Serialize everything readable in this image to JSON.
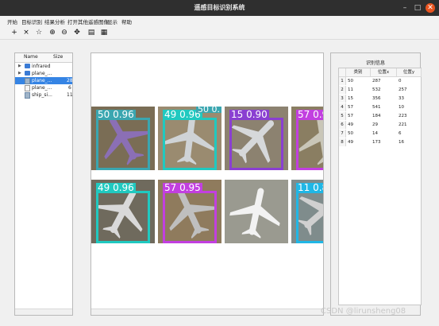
{
  "window": {
    "title": "遥感目标识别系统",
    "buttons": [
      "–",
      "□",
      "✕"
    ]
  },
  "menu": [
    "开始",
    "目标识别",
    "结果分析",
    "打开其他遥感图像",
    "显示",
    "帮助"
  ],
  "toolbar": [
    {
      "icon": "add-icon",
      "glyph": "+"
    },
    {
      "icon": "close-icon",
      "glyph": "×"
    },
    {
      "icon": "star-icon",
      "glyph": "☆"
    },
    {
      "icon": "zoom-in-icon",
      "glyph": "⊕"
    },
    {
      "icon": "zoom-out-icon",
      "glyph": "⊖"
    },
    {
      "icon": "move-icon",
      "glyph": "✥"
    },
    {
      "icon": "list-icon",
      "glyph": "▤"
    },
    {
      "icon": "table-icon",
      "glyph": "▦"
    }
  ],
  "file_tree": {
    "columns": [
      "Name",
      "Size"
    ],
    "rows": [
      {
        "name": "infrared",
        "size": "",
        "type": "folder",
        "expandable": true,
        "selected": false
      },
      {
        "name": "plane_...",
        "size": "",
        "type": "folder",
        "expandable": true,
        "selected": false
      },
      {
        "name": "plane_...",
        "size": "28",
        "type": "img",
        "expandable": false,
        "selected": true
      },
      {
        "name": "plane_...",
        "size": "6",
        "type": "file",
        "expandable": false,
        "selected": false
      },
      {
        "name": "ship_si...",
        "size": "11",
        "type": "img",
        "expandable": false,
        "selected": false
      }
    ]
  },
  "detections_view": {
    "tiles": [
      {
        "row": 0,
        "col": 0,
        "bg": "#7a6d55",
        "plane": "#8b6fb5",
        "box": {
          "color": "#3aa6b0",
          "label": "50  0.96"
        }
      },
      {
        "row": 0,
        "col": 1,
        "bg": "#9a8b70",
        "plane": "#cfd3d6",
        "box": {
          "color": "#20c9c0",
          "label": "49  0.96"
        }
      },
      {
        "row": 0,
        "col": 2,
        "bg": "#8c8270",
        "plane": "#d6d8da",
        "box": {
          "color": "#8a3fd1",
          "label": "15  0.90"
        }
      },
      {
        "row": 0,
        "col": 3,
        "bg": "#8a7e62",
        "plane": "#c9c6b8",
        "box": {
          "color": "#c23fe0",
          "label": "57  0.9"
        }
      },
      {
        "row": 1,
        "col": 0,
        "bg": "#6f6a5d",
        "plane": "#d9d9d9",
        "box": {
          "color": "#20c9c0",
          "label": "49  0.96"
        }
      },
      {
        "row": 1,
        "col": 1,
        "bg": "#8f7b5d",
        "plane": "#bfbfbf",
        "box": {
          "color": "#c23fe0",
          "label": "57  0.95"
        }
      },
      {
        "row": 1,
        "col": 2,
        "bg": "#9a9a90",
        "plane": "#f2f2f2",
        "box": null
      },
      {
        "row": 1,
        "col": 3,
        "bg": "#7f8c8c",
        "plane": "#d0d0d0",
        "box": {
          "color": "#20b7e6",
          "label": "11  0.8"
        }
      }
    ],
    "extra_label": {
      "text": "50  0.",
      "color": "#3aa6b0"
    }
  },
  "results": {
    "title": "识别信息",
    "columns": [
      "类别",
      "位置x",
      "位置y"
    ],
    "rows": [
      [
        "1",
        "50",
        "287",
        "0"
      ],
      [
        "2",
        "11",
        "532",
        "257"
      ],
      [
        "3",
        "15",
        "356",
        "33"
      ],
      [
        "4",
        "57",
        "541",
        "10"
      ],
      [
        "5",
        "57",
        "184",
        "223"
      ],
      [
        "6",
        "49",
        "29",
        "221"
      ],
      [
        "7",
        "50",
        "14",
        "6"
      ],
      [
        "8",
        "49",
        "173",
        "16"
      ]
    ]
  },
  "watermark": "CSDN @lirunsheng08"
}
